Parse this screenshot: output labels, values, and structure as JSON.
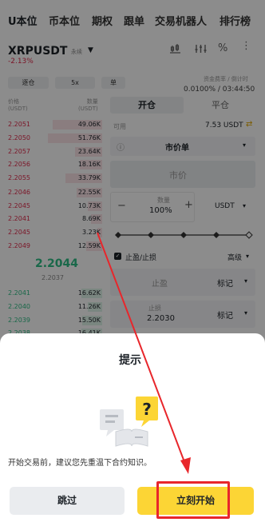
{
  "top_tabs": [
    "U本位",
    "币本位",
    "期权",
    "跟单",
    "交易机器人",
    "排行榜"
  ],
  "symbol": "XRPUSDT",
  "contract_type": "永续",
  "price_change": "-2.13%",
  "controls": {
    "margin_mode": "逐仓",
    "leverage": "5x",
    "position_mode": "单"
  },
  "funding": {
    "label": "资金费率 / 倒计时",
    "value": "0.0100% / 03:44:50"
  },
  "orderbook": {
    "header_price": "价格",
    "header_price_unit": "(USDT)",
    "header_qty": "数量",
    "header_qty_unit": "(USDT)",
    "asks": [
      {
        "price": "2.2051",
        "qty": "49.06K"
      },
      {
        "price": "2.2050",
        "qty": "51.76K"
      },
      {
        "price": "2.2057",
        "qty": "23.64K"
      },
      {
        "price": "2.2056",
        "qty": "18.16K"
      },
      {
        "price": "2.2055",
        "qty": "33.79K"
      },
      {
        "price": "2.2046",
        "qty": "22.55K"
      },
      {
        "price": "2.2045",
        "qty": "10.73K"
      },
      {
        "price": "2.2041",
        "qty": "8.69K"
      },
      {
        "price": "2.2045",
        "qty": "3.23K"
      },
      {
        "price": "2.2049",
        "qty": "12.59K"
      }
    ],
    "last_price": "2.2044",
    "mark_price": "2.2037",
    "bids": [
      {
        "price": "2.2041",
        "qty": "16.62K"
      },
      {
        "price": "2.2040",
        "qty": "11.26K"
      },
      {
        "price": "2.2039",
        "qty": "15.50K"
      },
      {
        "price": "2.2038",
        "qty": "16.41K"
      }
    ]
  },
  "order_form": {
    "open_tab": "开仓",
    "close_tab": "平仓",
    "available_label": "可用",
    "available_value": "7.53 USDT",
    "order_type": "市价单",
    "price_placeholder": "市价",
    "amount_label": "数量",
    "amount_value": "100%",
    "amount_unit": "USDT",
    "tpsl_label": "止盈/止损",
    "advanced_label": "高级",
    "take_profit_placeholder": "止盈",
    "take_profit_ref": "标记",
    "stop_loss_label": "止损",
    "stop_loss_value": "2.2030",
    "stop_loss_ref": "标记"
  },
  "dialog": {
    "title": "提示",
    "message": "开始交易前，建议您先重温下合约知识。",
    "skip_label": "跳过",
    "start_label": "立刻开始"
  },
  "colors": {
    "accent_yellow": "#fcd535",
    "ask_red": "#e0294a",
    "bid_green": "#2ebd85",
    "highlight_red": "#e8262b"
  },
  "icons": [
    "dropdown-caret-icon",
    "candles-icon",
    "settings-icon",
    "percent-icon",
    "more-icon",
    "info-icon",
    "question-illustration-icon"
  ]
}
